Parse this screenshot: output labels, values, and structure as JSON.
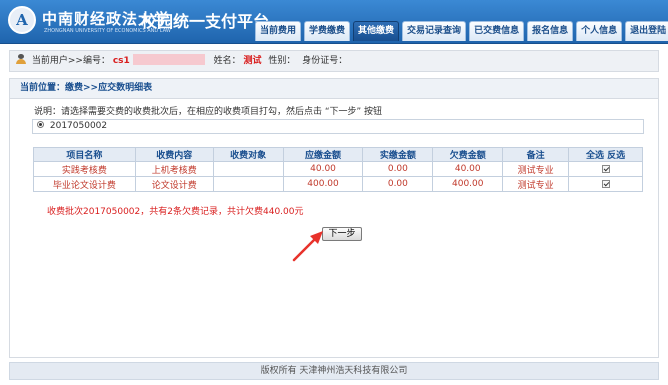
{
  "header": {
    "logo_glyph": "A",
    "school_name": "中南财经政法大学",
    "school_english": "ZHONGNAN UNIVERSITY OF ECONOMICS AND LAW",
    "system_title": "校园统一支付平台",
    "nav": [
      {
        "label": "当前费用",
        "active": false
      },
      {
        "label": "学费缴费",
        "active": false
      },
      {
        "label": "其他缴费",
        "active": true
      },
      {
        "label": "交易记录查询",
        "active": false
      },
      {
        "label": "已交费信息",
        "active": false
      },
      {
        "label": "报名信息",
        "active": false
      },
      {
        "label": "个人信息",
        "active": false
      },
      {
        "label": "退出登陆",
        "active": false
      }
    ]
  },
  "user": {
    "current_user_label": "当前用户>>编号：",
    "id_value": "cs1",
    "name_label": "姓名：",
    "name_value": "测试",
    "gender_label": "性别：",
    "idcard_label": "身份证号："
  },
  "main": {
    "breadcrumb": "当前位置：缴费>>应交数明细表",
    "instruction": "说明：请选择需要交费的收费批次后，在相应的收费项目打勾，然后点击 “下一步” 按钮",
    "batch_option": "2017050002",
    "table": {
      "headers": [
        "项目名称",
        "收费内容",
        "收费对象",
        "应缴金额",
        "实缴金额",
        "欠费金额",
        "备注",
        "全选 反选"
      ],
      "rows": [
        [
          "实践考核费",
          "上机考核费",
          "",
          "40.00",
          "0.00",
          "40.00",
          "测试专业"
        ],
        [
          "毕业论文设计费",
          "论文设计费",
          "",
          "400.00",
          "0.00",
          "400.00",
          "测试专业"
        ]
      ]
    },
    "summary": "收费批次2017050002，共有2条欠费记录，共计欠费440.00元",
    "next_button": "下一步"
  },
  "footer": {
    "copyright": "版权所有 天津神州浩天科技有限公司"
  },
  "colors": {
    "header_blue": "#1f64ad",
    "alert_red": "#d91e1e",
    "arrow_red": "#e8322b"
  }
}
